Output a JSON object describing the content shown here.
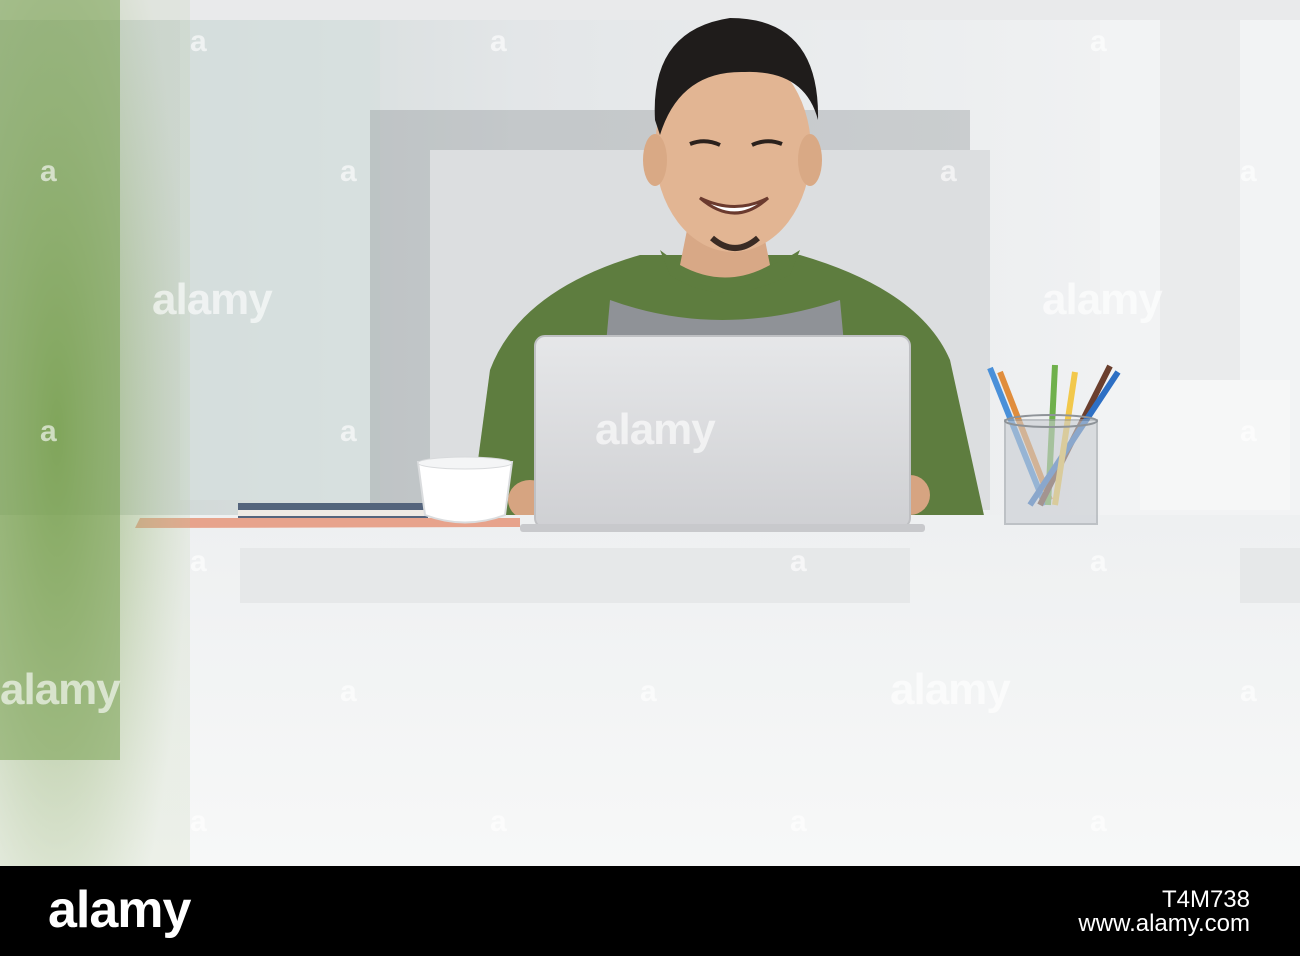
{
  "photo": {
    "description_colors": {
      "background": "#eceef0",
      "sleeve_green": "#5e7d3f",
      "shirt_gray": "#8f9297",
      "laptop_silver": "#d9dadc",
      "desk_white": "#f1f2f3"
    }
  },
  "watermarks": {
    "text": "alamy",
    "mark": "a"
  },
  "footer": {
    "logo": "alamy",
    "image_id": "T4M738",
    "site": "www.alamy.com"
  }
}
